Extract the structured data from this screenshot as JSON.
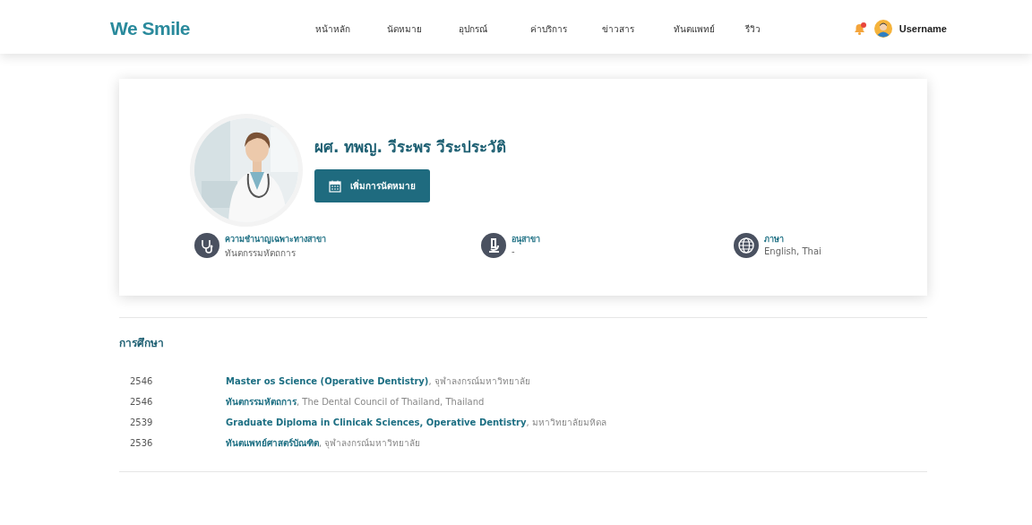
{
  "header": {
    "logo": "We Smile",
    "nav": [
      {
        "label": "หน้าหลัก"
      },
      {
        "label": "นัดหมาย"
      },
      {
        "label": "อุปกรณ์"
      },
      {
        "label": "ค่าบริการ"
      },
      {
        "label": "ข่าวสาร"
      },
      {
        "label": "ทันตแพทย์"
      },
      {
        "label": "รีวิว"
      }
    ],
    "notification": {
      "unread": true
    },
    "user": {
      "name": "Username"
    }
  },
  "profile": {
    "name": "ผศ. ทพญ. วีระพร วีระประวัติ",
    "appointment_button": "เพิ่มการนัดหมาย",
    "details": [
      {
        "kind": "specialty",
        "label": "ความชำนาญเฉพาะทางสาขา",
        "value": "ทันตกรรมหัตถการ"
      },
      {
        "kind": "subspecialty",
        "label": "อนุสาขา",
        "value": "-"
      },
      {
        "kind": "language",
        "label": "ภาษา",
        "value": "English, Thai"
      }
    ]
  },
  "education": {
    "title": "การศึกษา",
    "rows": [
      {
        "year": "2546",
        "text": "**Master os Science (Operative Dentistry)**, จุฬาลงกรณ์มหาวิทยาลัย"
      },
      {
        "year": "2546",
        "text": "**ทันตกรรมหัตถการ**, The Dental Council of Thailand, Thailand"
      },
      {
        "year": "2539",
        "text": "**Graduate Diploma in Clinicak Sciences, Operative Dentistry**, มหาวิทยาลัยมหิดล"
      },
      {
        "year": "2536",
        "text": "**ทันตแพทย์ศาสตร์บัณฑิต**, จุฬาลงกรณ์มหาวิทยาลัย"
      }
    ]
  }
}
